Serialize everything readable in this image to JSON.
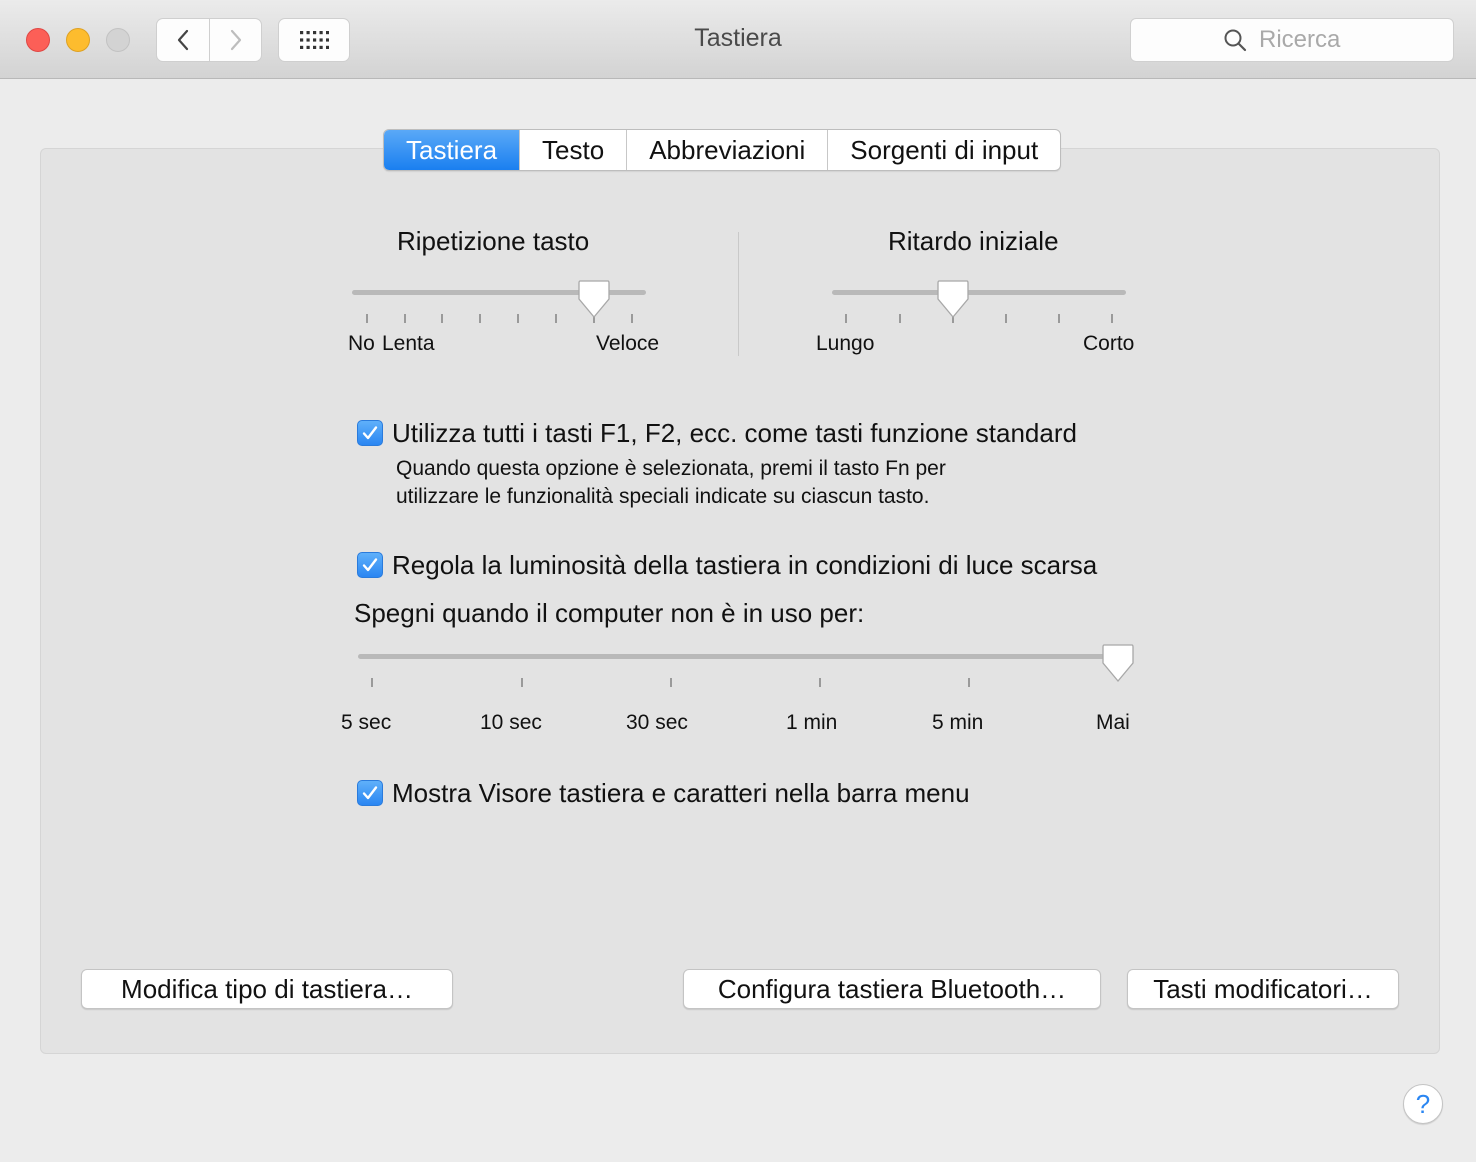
{
  "window": {
    "title": "Tastiera"
  },
  "toolbar": {
    "search_placeholder": "Ricerca"
  },
  "tabs": [
    {
      "label": "Tastiera",
      "active": true
    },
    {
      "label": "Testo",
      "active": false
    },
    {
      "label": "Abbreviazioni",
      "active": false
    },
    {
      "label": "Sorgenti di input",
      "active": false
    }
  ],
  "key_repeat": {
    "title": "Ripetizione tasto",
    "label_left_1": "No",
    "label_left_2": "Lenta",
    "label_right": "Veloce",
    "position_fraction": 0.83
  },
  "initial_delay": {
    "title": "Ritardo iniziale",
    "label_left": "Lungo",
    "label_right": "Corto",
    "position_fraction": 0.41
  },
  "options": {
    "function_keys": {
      "label": "Utilizza tutti i tasti F1, F2, ecc. come tasti funzione standard",
      "checked": true,
      "description_line1": "Quando questa opzione è selezionata, premi il tasto Fn per",
      "description_line2": "utilizzare le funzionalità speciali indicate su ciascun tasto."
    },
    "brightness": {
      "label": "Regola la luminosità della tastiera in condizioni di luce scarsa",
      "checked": true
    },
    "off_timer": {
      "label": "Spegni quando il computer non è in uso per:",
      "ticks": [
        "5 sec",
        "10 sec",
        "30 sec",
        "1 min",
        "5 min",
        "Mai"
      ],
      "selected": "Mai"
    },
    "keyboard_viewer": {
      "label": "Mostra Visore tastiera e caratteri nella barra menu",
      "checked": true
    }
  },
  "buttons": {
    "change_keyboard_type": "Modifica tipo di tastiera…",
    "setup_bluetooth_keyboard": "Configura tastiera Bluetooth…",
    "modifier_keys": "Tasti modificatori…"
  },
  "help": {
    "label": "?"
  },
  "icons": {
    "back": "chevron-left-icon",
    "forward": "chevron-right-icon",
    "grid": "grid-icon",
    "search": "search-icon",
    "check": "checkmark-icon"
  },
  "colors": {
    "accent": "#1a7ff0",
    "close": "#fc5f57",
    "minimize": "#fdbc2e",
    "zoom_disabled": "#d3d3d3"
  }
}
